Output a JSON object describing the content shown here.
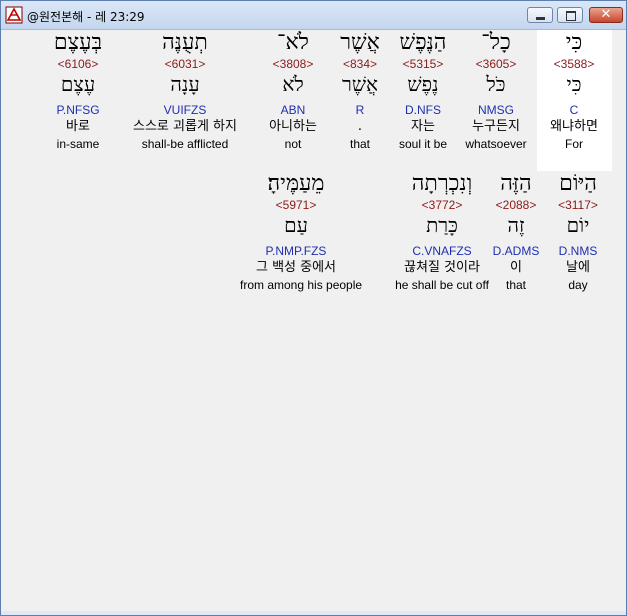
{
  "window": {
    "title": "@원전본해 - 레 23:29",
    "icon": "app-logo-icon",
    "controls": [
      "minimize-icon",
      "maximize-icon",
      "close-icon"
    ]
  },
  "colors": {
    "strong_number": "#8b1a1a",
    "morph_code": "#1f2fb0",
    "highlight_bg": "#ffffff"
  },
  "rows": [
    {
      "words": [
        {
          "hebrew": "כִּי",
          "strong": "<3588>",
          "lemma": "כִּי",
          "morph": "C",
          "korean": "왜냐하면",
          "english": "For",
          "selected": true
        },
        {
          "hebrew": "כָל־",
          "strong": "<3605>",
          "lemma": "כֹּל",
          "morph": "NMSG",
          "korean": "누구든지",
          "english": "whatsoever"
        },
        {
          "hebrew": "הַנֶּפֶשׁ",
          "strong": "<5315>",
          "lemma": "נֶפֶשׁ",
          "morph": "D.NFS",
          "korean": "자는",
          "english": "soul it be"
        },
        {
          "hebrew": "אֲשֶׁר",
          "strong": "<834>",
          "lemma": "אֲשֶׁר",
          "morph": "R",
          "korean": ".",
          "english": "that"
        },
        {
          "hebrew": "לֹא־",
          "strong": "<3808>",
          "lemma": "לֹא",
          "morph": "ABN",
          "korean": "아니하는",
          "english": "not"
        },
        {
          "hebrew": "תְעֻנֶּה",
          "strong": "<6031>",
          "lemma": "עָנָה",
          "morph": "VUIFZS",
          "korean": "스스로 괴롭게 하지",
          "english": "shall-be afflicted"
        },
        {
          "hebrew": "בְּעֶצֶם",
          "strong": "<6106>",
          "lemma": "עֶצֶם",
          "morph": "P.NFSG",
          "korean": "바로",
          "english": "in-same"
        }
      ]
    },
    {
      "words": [
        {
          "hebrew": "הַיּוֹם",
          "strong": "<3117>",
          "lemma": "יוֹם",
          "morph": "D.NMS",
          "korean": "날에",
          "english": "day"
        },
        {
          "hebrew": "הַזֶּה",
          "strong": "<2088>",
          "lemma": "זֶה",
          "morph": "D.ADMS",
          "korean": "이",
          "english": "that"
        },
        {
          "hebrew": "וְנִכְרְתָה",
          "strong": "<3772>",
          "lemma": "כָּרַת",
          "morph": "C.VNAFZS",
          "korean": "끊쳐질 것이라",
          "english": "he shall be cut off"
        },
        {
          "hebrew": "מֵעַמֶּיהָ׃",
          "strong": "<5971>",
          "lemma": "עַם",
          "morph": "P.NMP.FZS",
          "korean": "그 백성 중에서",
          "english": "from among his people"
        }
      ]
    }
  ]
}
